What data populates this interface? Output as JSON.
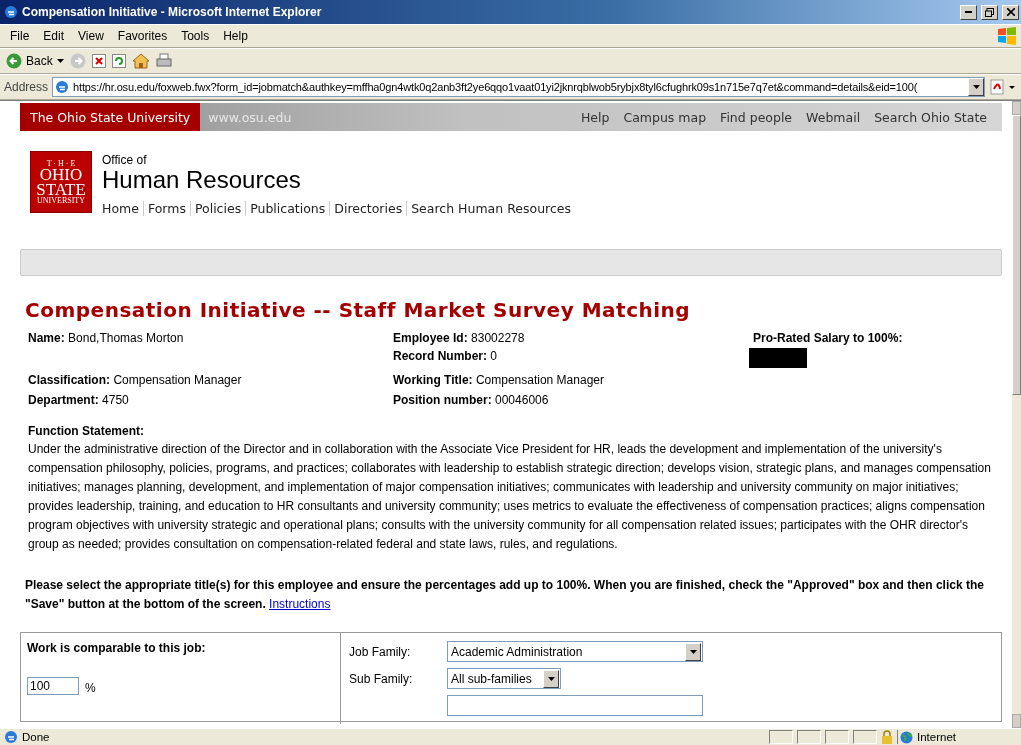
{
  "window": {
    "title": "Compensation Initiative - Microsoft Internet Explorer"
  },
  "menu": [
    "File",
    "Edit",
    "View",
    "Favorites",
    "Tools",
    "Help"
  ],
  "toolbar": {
    "back": "Back"
  },
  "address": {
    "label": "Address",
    "url": "https://hr.osu.edu/foxweb.fwx?form_id=jobmatch&authkey=mffha0gn4wtk0q2anb3ft2ye6qqo1vaat01yi2jknrqblwob5rybjx8tyl6cfughrk09s1n715e7q7et&command=details&eid=100("
  },
  "site_bar": {
    "name": "The Ohio State University",
    "url": "www.osu.edu",
    "links": [
      "Help",
      "Campus map",
      "Find people",
      "Webmail",
      "Search Ohio State"
    ]
  },
  "header": {
    "logo": {
      "top": "T · H · E",
      "line1": "OHIO",
      "line2": "STATE",
      "bottom": "UNIVERSITY"
    },
    "office_of": "Office of",
    "title": "Human Resources",
    "nav": [
      "Home",
      "Forms",
      "Policies",
      "Publications",
      "Directories",
      "Search Human Resources"
    ]
  },
  "page_title": "Compensation Initiative -- Staff Market Survey Matching",
  "info_rows": [
    {
      "columns": [
        [
          {
            "kind": "text",
            "label": "Name:",
            "value": "Bond,Thomas Morton"
          }
        ],
        [
          {
            "kind": "text",
            "label": "Employee Id:",
            "value": "83002278"
          },
          {
            "kind": "text",
            "label": "Record Number:",
            "value": "0"
          }
        ],
        [
          {
            "kind": "redacted",
            "label": "Pro-Rated Salary to 100%:"
          }
        ]
      ]
    },
    {
      "columns": [
        [
          {
            "kind": "text",
            "label": "Classification:",
            "value": "Compensation Manager"
          }
        ],
        [
          {
            "kind": "text",
            "label": "Working Title:",
            "value": "Compensation Manager"
          }
        ],
        []
      ]
    },
    {
      "columns": [
        [
          {
            "kind": "text",
            "label": "Department:",
            "value": "4750"
          }
        ],
        [
          {
            "kind": "text",
            "label": "Position number:",
            "value": "00046006"
          }
        ],
        []
      ]
    }
  ],
  "function_statement": {
    "label": "Function Statement:",
    "text": "Under the administrative direction of the Director and in collaboration with the Associate Vice President for HR, leads the development and implementation of the university's compensation philosophy, policies, programs, and practices; collaborates with leadership to establish strategic direction; develops vision, strategic plans, and manages compensation initiatives; manages planning, development, and implementation of major compensation initiatives; communicates with leadership and university community on major initiatives; provides leadership, training, and education to HR consultants and university community; uses metrics to evaluate the effectiveness of compensation practices; aligns compensation program objectives with university strategic and operational plans; consults with the university community for all compensation related issues; participates with the OHR director's group as needed; provides consultation on compensation-related federal and state laws, rules, and regulations."
  },
  "instructions": {
    "text": "Please select the appropriate title(s) for this employee and ensure the percentages add up to 100%. When you are finished, check the \"Approved\" box and then click the \"Save\" button at the bottom of the screen.",
    "link": "Instructions"
  },
  "match_form": {
    "label": "Work is comparable to this job:",
    "percent": "100",
    "unit": "%",
    "selects": [
      {
        "label": "Job Family:",
        "value": "Academic Administration",
        "wide": true
      },
      {
        "label": "Sub Family:",
        "value": "All sub-families",
        "wide": false
      }
    ]
  },
  "status_bar": {
    "text": "Done",
    "zone": "Internet"
  }
}
